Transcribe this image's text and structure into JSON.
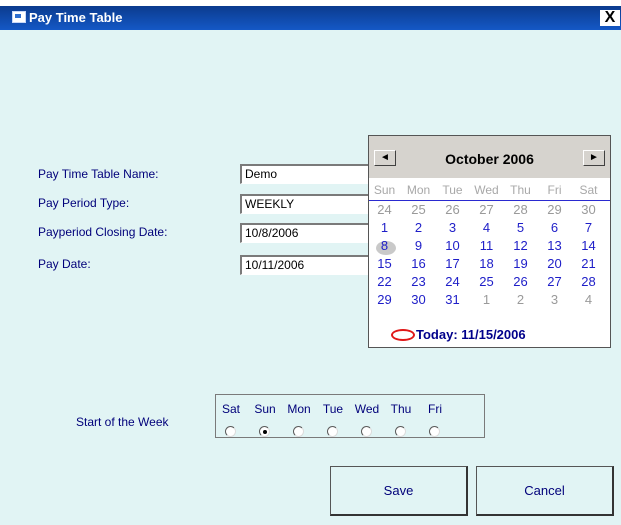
{
  "window": {
    "title": "Pay Time Table",
    "close_glyph": "X"
  },
  "form": {
    "name_label": "Pay Time Table Name:",
    "name_value": "Demo",
    "period_type_label": "Pay Period Type:",
    "period_type_value": "WEEKLY",
    "closing_date_label": "Payperiod Closing Date:",
    "closing_date_value": "10/8/2006",
    "pay_date_label": "Pay Date:",
    "pay_date_value": "10/11/2006"
  },
  "calendar": {
    "month_label": "October 2006",
    "prev_glyph": "◄",
    "next_glyph": "►",
    "day_names": [
      "Sun",
      "Mon",
      "Tue",
      "Wed",
      "Thu",
      "Fri",
      "Sat"
    ],
    "weeks": [
      [
        {
          "d": "24",
          "o": true
        },
        {
          "d": "25",
          "o": true
        },
        {
          "d": "26",
          "o": true
        },
        {
          "d": "27",
          "o": true
        },
        {
          "d": "28",
          "o": true
        },
        {
          "d": "29",
          "o": true
        },
        {
          "d": "30",
          "o": true
        }
      ],
      [
        {
          "d": "1"
        },
        {
          "d": "2"
        },
        {
          "d": "3"
        },
        {
          "d": "4"
        },
        {
          "d": "5"
        },
        {
          "d": "6"
        },
        {
          "d": "7"
        }
      ],
      [
        {
          "d": "8",
          "sel": true
        },
        {
          "d": "9"
        },
        {
          "d": "10"
        },
        {
          "d": "11"
        },
        {
          "d": "12"
        },
        {
          "d": "13"
        },
        {
          "d": "14"
        }
      ],
      [
        {
          "d": "15"
        },
        {
          "d": "16"
        },
        {
          "d": "17"
        },
        {
          "d": "18"
        },
        {
          "d": "19"
        },
        {
          "d": "20"
        },
        {
          "d": "21"
        }
      ],
      [
        {
          "d": "22"
        },
        {
          "d": "23"
        },
        {
          "d": "24"
        },
        {
          "d": "25"
        },
        {
          "d": "26"
        },
        {
          "d": "27"
        },
        {
          "d": "28"
        }
      ],
      [
        {
          "d": "29"
        },
        {
          "d": "30"
        },
        {
          "d": "31"
        },
        {
          "d": "1",
          "o": true
        },
        {
          "d": "2",
          "o": true
        },
        {
          "d": "3",
          "o": true
        },
        {
          "d": "4",
          "o": true
        }
      ]
    ],
    "today_label": "Today: 11/15/2006"
  },
  "week_start": {
    "label": "Start of the Week",
    "days": [
      "Sat",
      "Sun",
      "Mon",
      "Tue",
      "Wed",
      "Thu",
      "Fri"
    ],
    "selected": "Sun"
  },
  "buttons": {
    "save": "Save",
    "cancel": "Cancel"
  },
  "colors": {
    "label_blue": "#00007a",
    "title_bar": "#0b3b8e",
    "form_bg": "#e1f4f4",
    "today_red": "#e01818"
  }
}
